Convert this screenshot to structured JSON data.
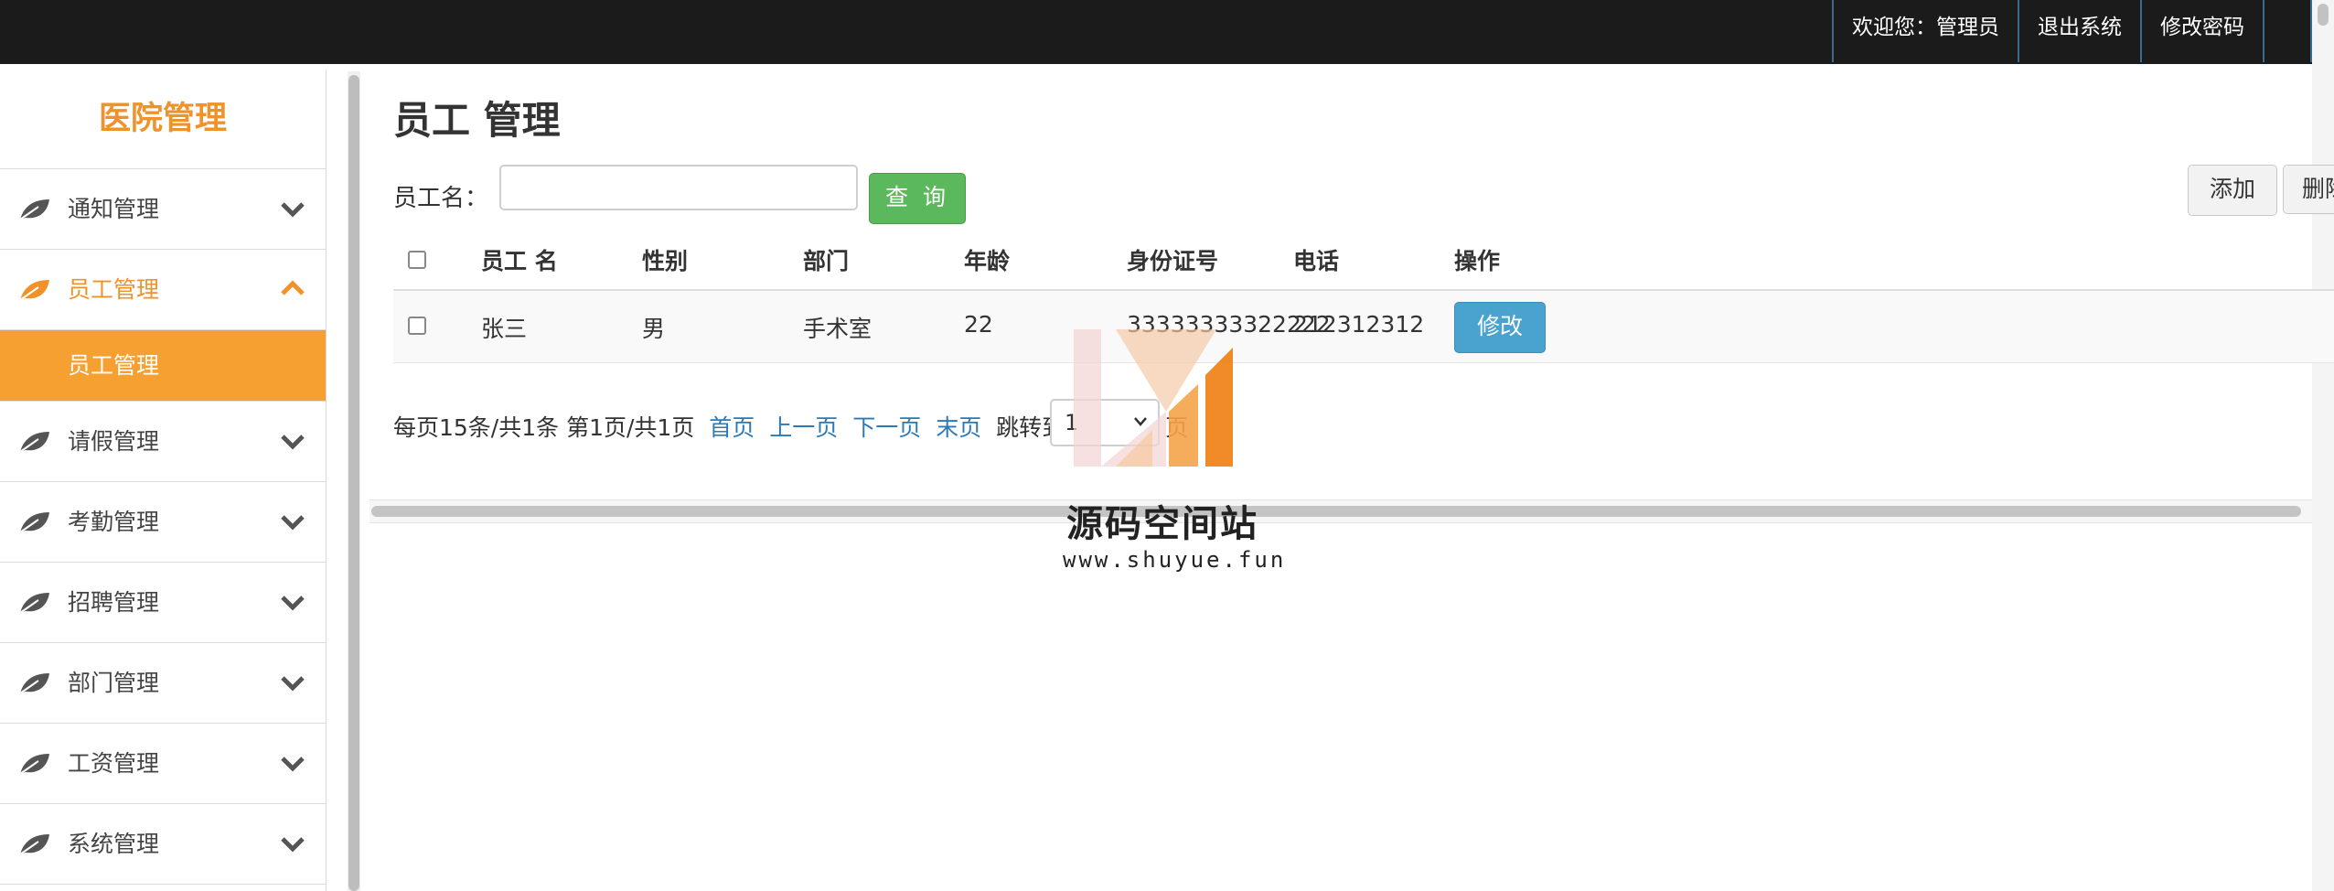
{
  "topbar": {
    "welcome": "欢迎您：管理员",
    "logout": "退出系统",
    "change_password": "修改密码"
  },
  "sidebar": {
    "brand": "医院管理",
    "items": [
      {
        "label": "通知管理",
        "icon": "leaf-icon"
      },
      {
        "label": "员工管理",
        "icon": "leaf-icon",
        "expanded": true,
        "sub": "员工管理"
      },
      {
        "label": "请假管理",
        "icon": "leaf-icon"
      },
      {
        "label": "考勤管理",
        "icon": "leaf-icon"
      },
      {
        "label": "招聘管理",
        "icon": "leaf-icon"
      },
      {
        "label": "部门管理",
        "icon": "leaf-icon"
      },
      {
        "label": "工资管理",
        "icon": "leaf-icon"
      },
      {
        "label": "系统管理",
        "icon": "leaf-icon"
      }
    ]
  },
  "main": {
    "title": "员工 管理",
    "search": {
      "label": "员工名：",
      "value": "",
      "placeholder": ""
    },
    "query_button": "查 询",
    "add_button": "添加",
    "delete_button": "删除",
    "table": {
      "headers": [
        "员工 名",
        "性别",
        "部门",
        "年龄",
        "身份证号",
        "电话",
        "操作"
      ],
      "rows": [
        {
          "name": "张三",
          "gender": "男",
          "department": "手术室",
          "age": "22",
          "id_card": "33333333322222",
          "phone": "212312312",
          "action": "修改"
        }
      ]
    },
    "pagination": {
      "summary": "每页15条/共1条 第1页/共1页",
      "first": "首页",
      "prev": "上一页",
      "next": "下一页",
      "last": "末页",
      "jump_label": "跳转到第",
      "page_value": "1",
      "suffix": "页"
    }
  },
  "watermark": {
    "name": "源码空间站",
    "url": "www.shuyue.fun"
  },
  "colors": {
    "accent": "#f0922a",
    "topbar": "#1b1b1b",
    "query_green": "#5cb85c",
    "edit_blue": "#4aa3cf",
    "link": "#2a7ab8"
  }
}
